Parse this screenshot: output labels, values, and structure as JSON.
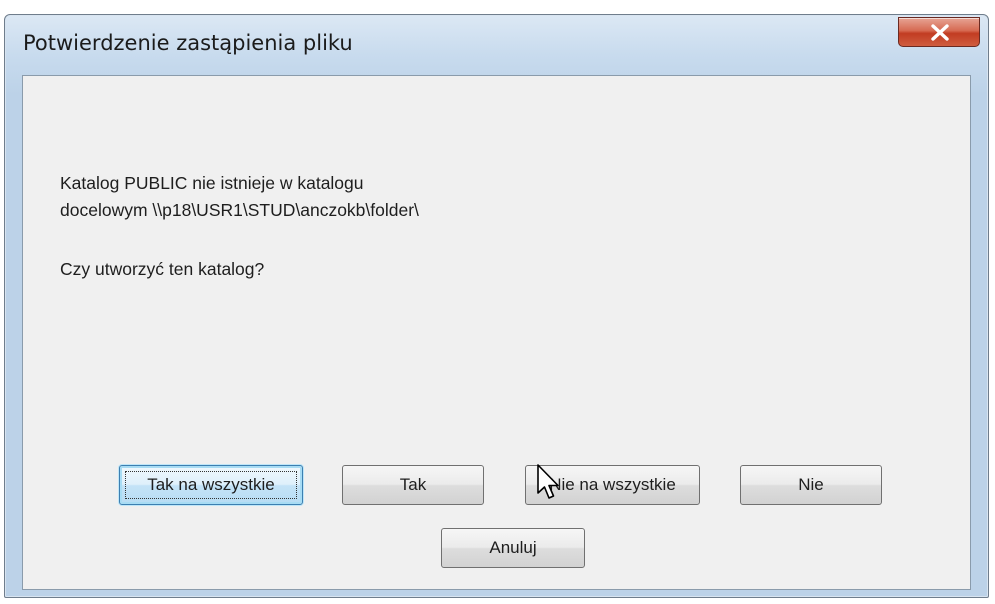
{
  "dialog": {
    "title": "Potwierdzenie zastąpienia pliku",
    "message_line1": "Katalog PUBLIC nie istnieje w katalogu",
    "message_line2": "docelowym \\\\p18\\USR1\\STUD\\anczokb\\folder\\",
    "question": "Czy utworzyć ten katalog?",
    "buttons": {
      "yes_to_all": "Tak na wszystkie",
      "yes": "Tak",
      "no_to_all": "Nie na wszystkie",
      "no": "Nie",
      "cancel": "Anuluj"
    },
    "close_icon": "close-x-icon",
    "cursor_icon": "mouse-pointer-icon"
  }
}
